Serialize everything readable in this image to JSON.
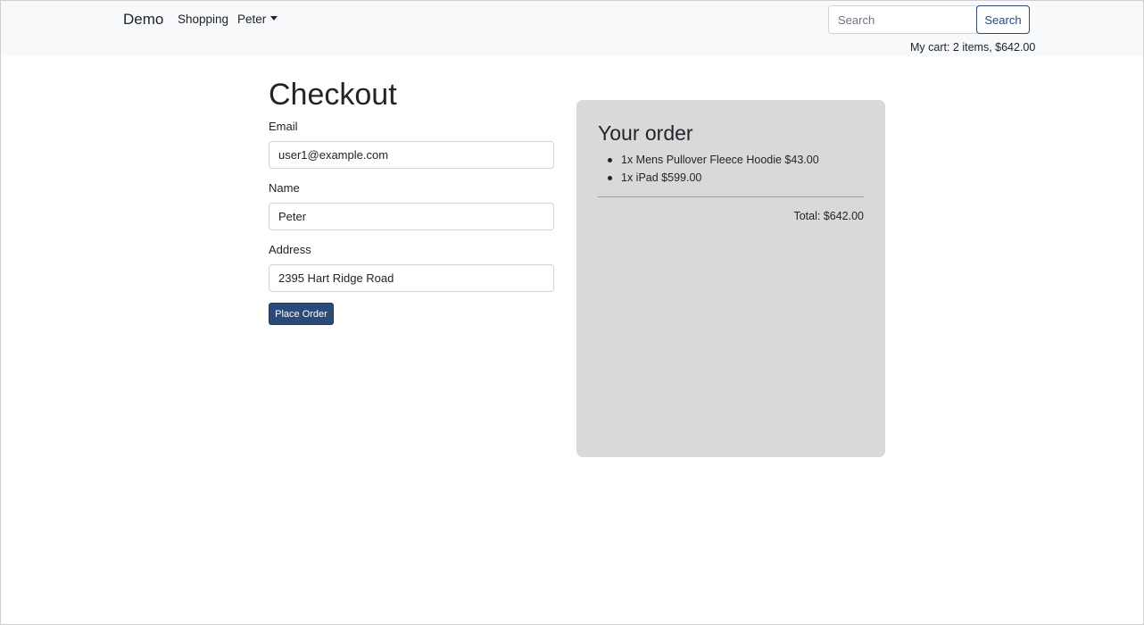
{
  "navbar": {
    "brand": "Demo",
    "links": [
      "Shopping",
      "Peter"
    ],
    "search": {
      "placeholder": "Search",
      "button_label": "Search"
    },
    "cart_summary": "My cart: 2 items, $642.00"
  },
  "checkout": {
    "title": "Checkout",
    "fields": [
      {
        "label": "Email",
        "value": "user1@example.com"
      },
      {
        "label": "Name",
        "value": "Peter"
      },
      {
        "label": "Address",
        "value": "2395 Hart Ridge Road"
      }
    ],
    "submit_label": "Place Order"
  },
  "order": {
    "title": "Your order",
    "items": [
      "1x Mens Pullover Fleece Hoodie $43.00",
      "1x iPad $599.00"
    ],
    "total": "Total: $642.00"
  },
  "colors": {
    "primary": "#2b4a78",
    "navbar_bg": "#f8f9fa",
    "panel_bg": "#d9d9d9"
  }
}
